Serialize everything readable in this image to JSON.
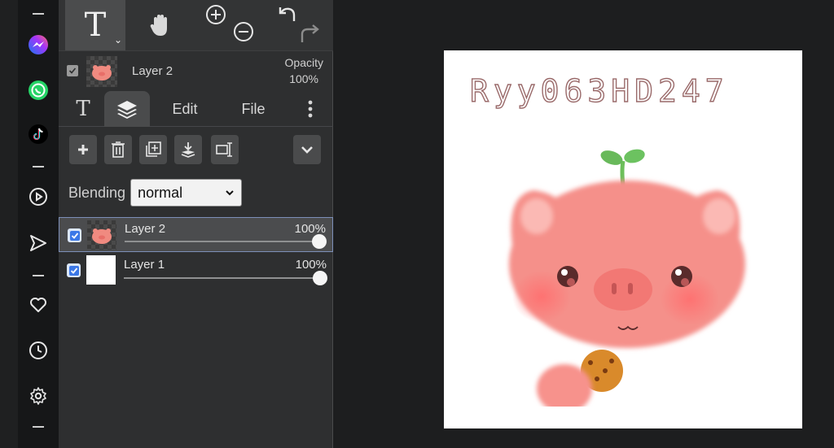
{
  "sidebar": {
    "icons": [
      "messenger-icon",
      "whatsapp-icon",
      "tiktok-icon",
      "play-icon",
      "send-icon",
      "heart-icon",
      "clock-icon",
      "settings-icon"
    ]
  },
  "toolbar": {
    "tools": [
      "text-tool",
      "hand-tool",
      "zoom-in",
      "zoom-out",
      "undo",
      "redo"
    ],
    "text_tool_glyph": "T"
  },
  "layer_header": {
    "name": "Layer 2",
    "opacity_label": "Opacity",
    "opacity_value": "100%"
  },
  "tabs": {
    "text_glyph": "T",
    "edit": "Edit",
    "file": "File"
  },
  "blending": {
    "label": "Blending",
    "value": "normal"
  },
  "layers": [
    {
      "name": "Layer 2",
      "opacity": "100%",
      "selected": true
    },
    {
      "name": "Layer 1",
      "opacity": "100%",
      "selected": false
    }
  ],
  "canvas": {
    "text": "Ryy063HD247"
  }
}
